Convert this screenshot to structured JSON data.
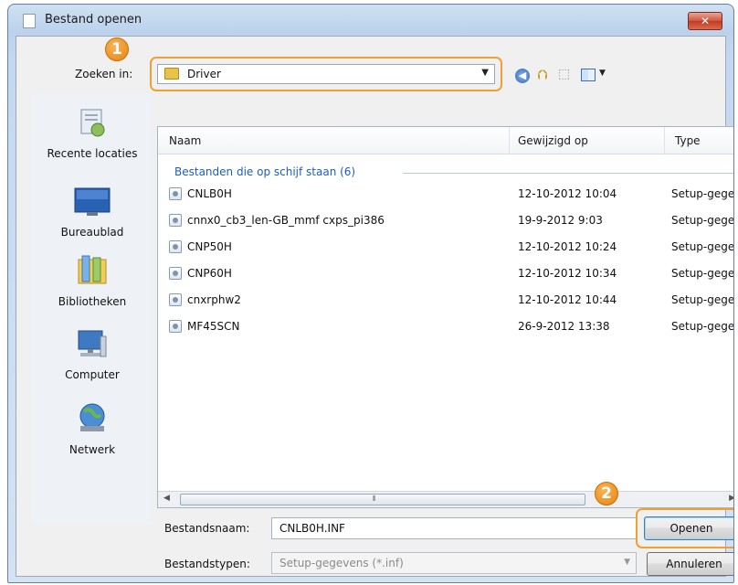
{
  "window": {
    "title": "Bestand openen",
    "close_label": "✕"
  },
  "lookin": {
    "label": "Zoeken in:",
    "value": "Driver"
  },
  "callouts": {
    "one": "1",
    "two": "2"
  },
  "places": [
    {
      "label": "Recente locaties",
      "icon": "recent-places-icon"
    },
    {
      "label": "Bureaublad",
      "icon": "desktop-icon"
    },
    {
      "label": "Bibliotheken",
      "icon": "libraries-icon"
    },
    {
      "label": "Computer",
      "icon": "computer-icon"
    },
    {
      "label": "Netwerk",
      "icon": "network-icon"
    }
  ],
  "columns": {
    "name": "Naam",
    "date": "Gewijzigd op",
    "type": "Type"
  },
  "group_label": "Bestanden die op schijf staan (6)",
  "files": [
    {
      "name": "CNLB0H",
      "date": "12-10-2012 10:04",
      "type": "Setup-gegevens"
    },
    {
      "name": "cnnx0_cb3_len-GB_mmf      cxps_pi386",
      "date": "19-9-2012 9:03",
      "type": "Setup-gegevens"
    },
    {
      "name": "CNP50H",
      "date": "12-10-2012 10:24",
      "type": "Setup-gegevens"
    },
    {
      "name": "CNP60H",
      "date": "12-10-2012 10:34",
      "type": "Setup-gegevens"
    },
    {
      "name": "cnxrphw2",
      "date": "12-10-2012 10:44",
      "type": "Setup-gegevens"
    },
    {
      "name": "MF45SCN",
      "date": "26-9-2012 13:38",
      "type": "Setup-gegevens"
    }
  ],
  "filename": {
    "label": "Bestandsnaam:",
    "value": "CNLB0H.INF"
  },
  "filetype": {
    "label": "Bestandstypen:",
    "value": "Setup-gegevens (*.inf)"
  },
  "buttons": {
    "open": "Openen",
    "cancel": "Annuleren"
  }
}
